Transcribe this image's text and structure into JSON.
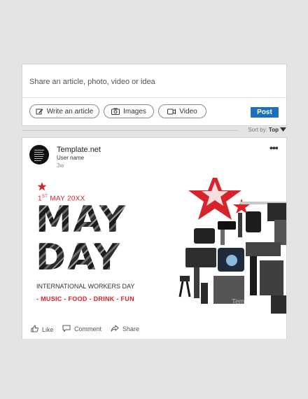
{
  "share_box": {
    "prompt": "Share an article, photo, video or idea",
    "actions": [
      {
        "label": "Write an article",
        "icon": "pencil-icon"
      },
      {
        "label": "Images",
        "icon": "camera-icon"
      },
      {
        "label": "Video",
        "icon": "video-camera-icon"
      }
    ],
    "post_label": "Post",
    "accent": "#1a6fbf"
  },
  "sort": {
    "label": "Sort by:",
    "value": "Top"
  },
  "post": {
    "author": "Template.net",
    "username": "User name",
    "time_ago": "3w",
    "more_label": "•••",
    "flyer": {
      "date_day": "1",
      "date_suffix": "ST",
      "date_rest": "MAY 20XX",
      "title_line1": "MAY",
      "title_line2": "DAY",
      "subtitle": "INTERNATIONAL WORKERS DAY",
      "tagline": "- MUSIC - FOOD - DRINK - FUN",
      "watermark": "Template",
      "accent": "#d8232a"
    },
    "actions": [
      {
        "label": "Like",
        "icon": "thumbs-up-icon"
      },
      {
        "label": "Comment",
        "icon": "comment-icon"
      },
      {
        "label": "Share",
        "icon": "share-icon"
      }
    ]
  }
}
